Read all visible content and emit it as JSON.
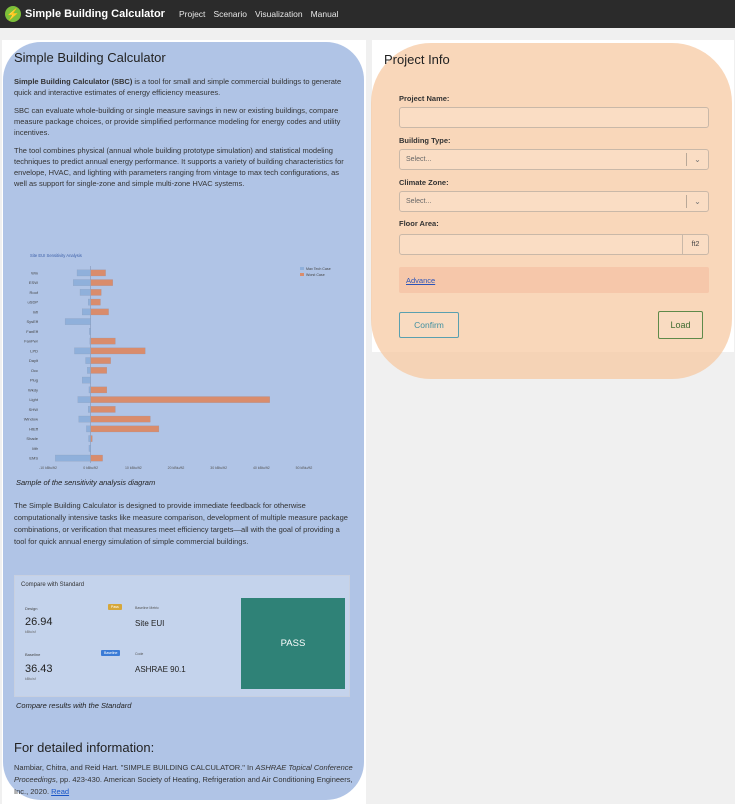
{
  "navbar": {
    "logo_icon": "lightning-bolt-icon",
    "brand": "Simple Building Calculator",
    "links": [
      "Project",
      "Scenario",
      "Visualization",
      "Manual"
    ]
  },
  "left": {
    "title": "Simple Building Calculator",
    "intro_bold": "Simple Building Calculator (SBC)",
    "intro_rest": " is a tool for small and simple commercial buildings to generate quick and interactive estimates of energy efficiency measures.",
    "para2": "SBC can evaluate whole-building or single measure savings in new or existing buildings, compare measure package choices, or provide simplified performance modeling for energy codes and utility incentives.",
    "para3": "The tool combines physical (annual whole building prototype simulation) and statistical modeling techniques to predict annual energy performance. It supports a variety of building characteristics for envelope, HVAC, and lighting with parameters ranging from vintage to max tech configurations, as well as support for single-zone and simple multi-zone HVAC systems.",
    "chart_caption": "Sample of the sensitivity analysis diagram",
    "para4": "The Simple Building Calculator is designed to provide immediate feedback for otherwise computationally intensive tasks like measure comparison, development of multiple measure package combinations, or verification that measures meet efficiency targets—all with the goal of providing a tool for quick annual energy simulation of simple commercial buildings.",
    "compare": {
      "title": "Compare with Standard",
      "design_label": "Design",
      "design_value": "26.94",
      "design_unit": "kBtu/sf",
      "baseline_label": "Baseline",
      "baseline_value": "36.43",
      "baseline_unit": "kBtu/sf",
      "metric_label": "Baseline Metric",
      "metric_value": "Site EUI",
      "code_label": "Code",
      "code_value": "ASHRAE 90.1",
      "badge_design": "Pass",
      "badge_baseline": "Baseline",
      "pass_text": "PASS",
      "badge_design_color": "#d6a73a",
      "badge_baseline_color": "#3b7bd6",
      "pass_color": "#2f8277"
    },
    "compare_caption": "Compare results with the Standard",
    "detail_title": "For detailed information:",
    "reference_pre": "Nambiar, Chitra, and Reid Hart. \"SIMPLE BUILDING CALCULATOR.\" In ",
    "reference_journal": "ASHRAE Topical Conference Proceedings",
    "reference_post": ", pp. 423-430. American Society of Heating, Refrigeration and Air Conditioning Engineers, Inc., 2020. ",
    "reference_link": "Read"
  },
  "chart_data": {
    "type": "bar",
    "title": "Site EUI Sensitivity Analysis",
    "orientation": "horizontal",
    "categories": [
      "Win",
      "ESW",
      "Roof",
      "uSDP",
      "Infl",
      "SysEff",
      "FanEff",
      "FanPwr",
      "LPD",
      "Daylt",
      "Occ",
      "Plug",
      "Wkdy",
      "Light",
      "SHW",
      "Window",
      "HtEff",
      "Shade",
      "Mfr",
      "EMS"
    ],
    "series": [
      {
        "name": "Max Tech Case",
        "color": "#8fb0db",
        "values": [
          -3.2,
          -4.1,
          -2.5,
          -0.6,
          -2.0,
          -6.0,
          -0.3,
          -0.2,
          -3.8,
          -1.2,
          -0.8,
          -2.0,
          -0.4,
          -3.0,
          -0.6,
          -2.8,
          -1.0,
          -0.5,
          -0.4,
          -8.3
        ]
      },
      {
        "name": "Worst Case",
        "color": "#d98c6c",
        "values": [
          3.5,
          5.2,
          2.5,
          2.3,
          4.2,
          0.0,
          0.0,
          5.8,
          12.8,
          4.7,
          3.8,
          0.0,
          3.8,
          42.0,
          5.8,
          14.0,
          16.0,
          0.4,
          0.0,
          2.8
        ]
      }
    ],
    "xlabel": "",
    "ylabel": "",
    "xlim": [
      -10,
      50
    ],
    "grid": false,
    "legend": "top-right"
  },
  "project": {
    "title": "Project Info",
    "name_label": "Project Name:",
    "name_value": "",
    "building_label": "Building Type:",
    "building_placeholder": "Select...",
    "climate_label": "Climate Zone:",
    "climate_placeholder": "Select...",
    "floor_label": "Floor Area:",
    "floor_value": "",
    "floor_unit": "ft2",
    "advance_link": "Advance",
    "confirm_label": "Confirm",
    "load_label": "Load"
  }
}
